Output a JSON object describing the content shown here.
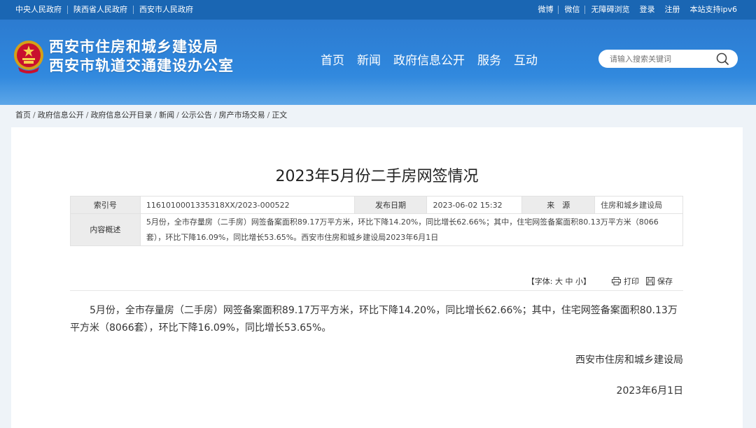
{
  "topbar": {
    "left_links": [
      "中央人民政府",
      "陕西省人民政府",
      "西安市人民政府"
    ],
    "right_links": [
      "微博",
      "微信",
      "无障碍浏览",
      "登录",
      "注册",
      "本站支持ipv6"
    ]
  },
  "header": {
    "title_line1": "西安市住房和城乡建设局",
    "title_line2": "西安市轨道交通建设办公室",
    "nav": [
      "首页",
      "新闻",
      "政府信息公开",
      "服务",
      "互动"
    ],
    "search_placeholder": "请输入搜索关键词"
  },
  "breadcrumb": [
    "首页",
    "政府信息公开",
    "政府信息公开目录",
    "新闻",
    "公示公告",
    "房产市场交易",
    "正文"
  ],
  "article": {
    "title": "2023年5月份二手房网签情况",
    "meta": {
      "index_label": "索引号",
      "index_value": "1161010001335318XX/2023-000522",
      "date_label": "发布日期",
      "date_value": "2023-06-02 15:32",
      "source_label": "来　源",
      "source_value": "住房和城乡建设局",
      "summary_label": "内容概述",
      "summary_value": "5月份，全市存量房（二手房）网签备案面积89.17万平方米，环比下降14.20%，同比增长62.66%；其中，住宅网签备案面积80.13万平方米（8066套），环比下降16.09%，同比增长53.65%。西安市住房和城乡建设局2023年6月1日"
    },
    "tools": {
      "font_size_label": "【字体: 大 中 小】",
      "print_label": "打印",
      "save_label": "保存"
    },
    "body": "5月份，全市存量房（二手房）网签备案面积89.17万平方米，环比下降14.20%，同比增长62.66%；其中，住宅网签备案面积80.13万平方米（8066套），环比下降16.09%，同比增长53.65%。",
    "signature": "西安市住房和城乡建设局",
    "sign_date": "2023年6月1日"
  },
  "colors": {
    "topbar": "#1a66b3",
    "header": "#2f86dc"
  },
  "icons": [
    "national-emblem-icon",
    "search-icon",
    "print-icon",
    "save-icon"
  ]
}
